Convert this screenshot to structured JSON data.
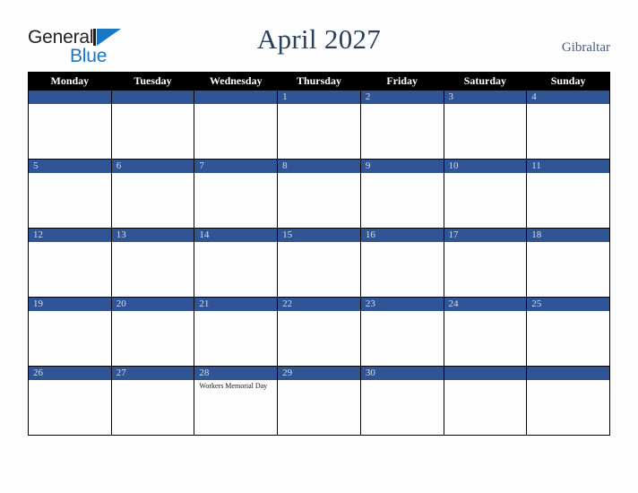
{
  "brand": {
    "name_part1": "General",
    "name_part2": "Blue",
    "mark_icon": "triangle-logo-icon",
    "accent_color": "#1b77c4",
    "text_color": "#231f20"
  },
  "header": {
    "title": "April 2027",
    "country": "Gibraltar",
    "title_color": "#27405e",
    "country_color": "#4a5d7e"
  },
  "calendar": {
    "month": "April",
    "year": "2027",
    "header_bg": "#000000",
    "header_fg": "#ffffff",
    "daynum_bg": "#2f5597",
    "daynum_fg": "#d8dde7",
    "cell_bg": "#fdfdfd",
    "border_color": "#000000",
    "weekday_headers": [
      "Monday",
      "Tuesday",
      "Wednesday",
      "Thursday",
      "Friday",
      "Saturday",
      "Sunday"
    ],
    "weeks": [
      [
        {
          "day": "",
          "events": []
        },
        {
          "day": "",
          "events": []
        },
        {
          "day": "",
          "events": []
        },
        {
          "day": "1",
          "events": []
        },
        {
          "day": "2",
          "events": []
        },
        {
          "day": "3",
          "events": []
        },
        {
          "day": "4",
          "events": []
        }
      ],
      [
        {
          "day": "5",
          "events": []
        },
        {
          "day": "6",
          "events": []
        },
        {
          "day": "7",
          "events": []
        },
        {
          "day": "8",
          "events": []
        },
        {
          "day": "9",
          "events": []
        },
        {
          "day": "10",
          "events": []
        },
        {
          "day": "11",
          "events": []
        }
      ],
      [
        {
          "day": "12",
          "events": []
        },
        {
          "day": "13",
          "events": []
        },
        {
          "day": "14",
          "events": []
        },
        {
          "day": "15",
          "events": []
        },
        {
          "day": "16",
          "events": []
        },
        {
          "day": "17",
          "events": []
        },
        {
          "day": "18",
          "events": []
        }
      ],
      [
        {
          "day": "19",
          "events": []
        },
        {
          "day": "20",
          "events": []
        },
        {
          "day": "21",
          "events": []
        },
        {
          "day": "22",
          "events": []
        },
        {
          "day": "23",
          "events": []
        },
        {
          "day": "24",
          "events": []
        },
        {
          "day": "25",
          "events": []
        }
      ],
      [
        {
          "day": "26",
          "events": []
        },
        {
          "day": "27",
          "events": []
        },
        {
          "day": "28",
          "events": [
            "Workers Memorial Day"
          ]
        },
        {
          "day": "29",
          "events": []
        },
        {
          "day": "30",
          "events": []
        },
        {
          "day": "",
          "events": []
        },
        {
          "day": "",
          "events": []
        }
      ]
    ]
  }
}
